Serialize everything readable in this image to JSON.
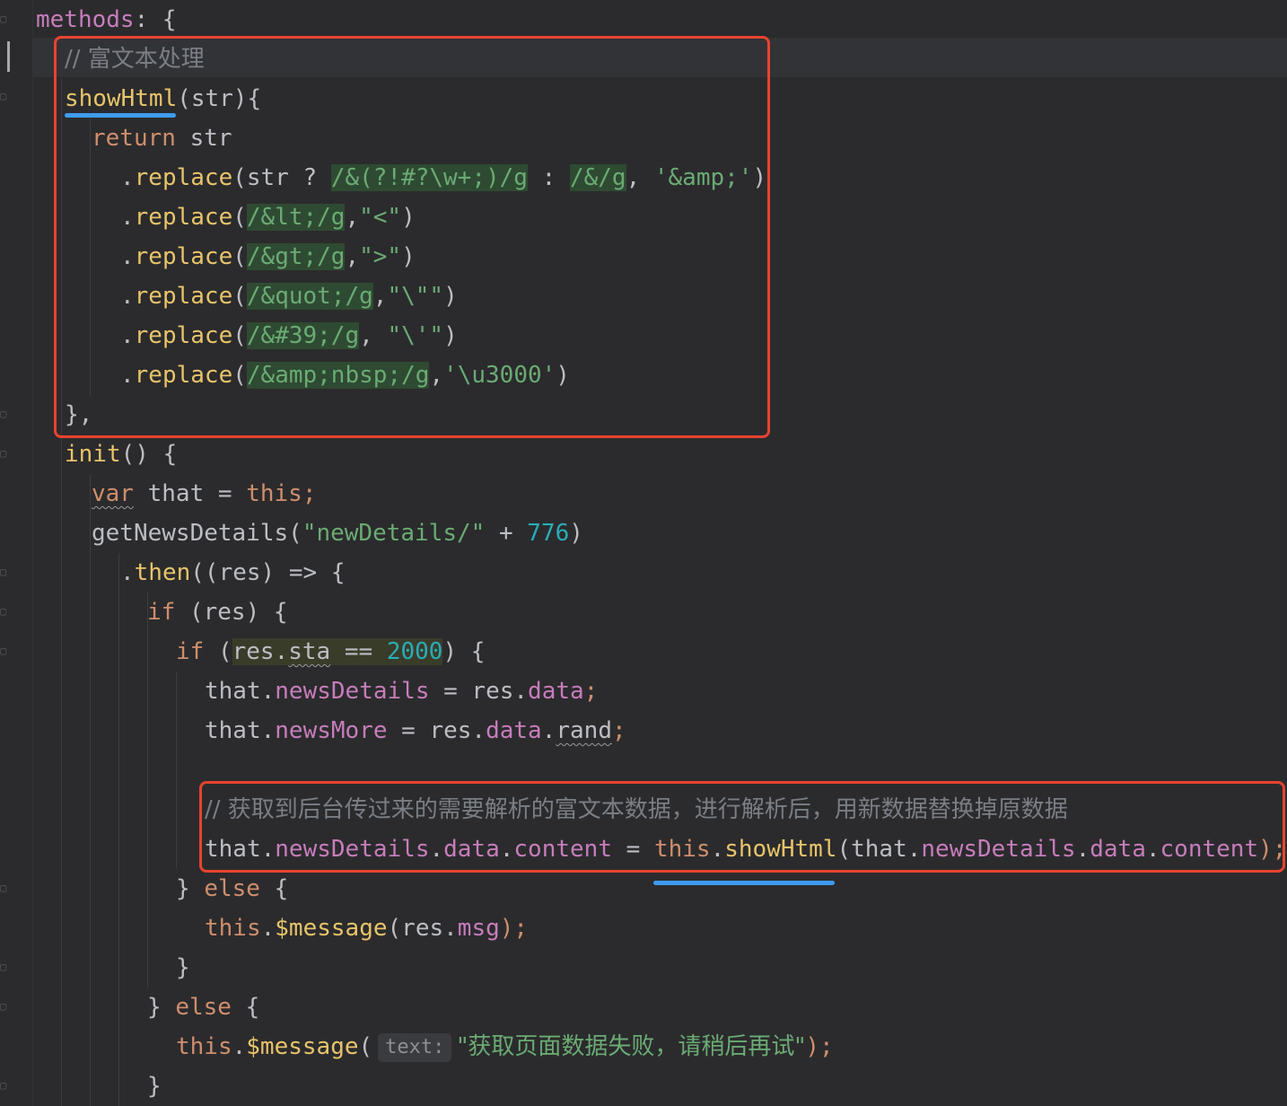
{
  "lines": {
    "l0": {
      "a": "methods",
      "b": ": {"
    },
    "l1": {
      "a": "// 富文本处理"
    },
    "l2": {
      "a": "showHtml",
      "b": "(str){"
    },
    "l3": {
      "a": "return",
      "b": " str"
    },
    "l4": {
      "a": ".",
      "b": "replace",
      "c": "(str ? ",
      "d": "/&(?!#?\\w+;)/g",
      "e": " : ",
      "f": "/&/g",
      "g": ", ",
      "h": "'&amp;'",
      "i": ")"
    },
    "l5": {
      "a": ".",
      "b": "replace",
      "c": "(",
      "d": "/&lt;/g",
      "e": ",",
      "f": "\"<\"",
      "g": ")"
    },
    "l6": {
      "a": ".",
      "b": "replace",
      "c": "(",
      "d": "/&gt;/g",
      "e": ",",
      "f": "\">\"",
      "g": ")"
    },
    "l7": {
      "a": ".",
      "b": "replace",
      "c": "(",
      "d": "/&quot;/g",
      "e": ",",
      "f": "\"\\\"\"",
      "g": ")"
    },
    "l8": {
      "a": ".",
      "b": "replace",
      "c": "(",
      "d": "/&#39;/g",
      "e": ", ",
      "f": "\"\\'\"",
      "g": ")"
    },
    "l9": {
      "a": ".",
      "b": "replace",
      "c": "(",
      "d": "/&amp;nbsp;/g",
      "e": ",",
      "f": "'\\u3000'",
      "g": ")"
    },
    "l10": {
      "a": "},"
    },
    "l11": {
      "a": "init",
      "b": "() {"
    },
    "l12": {
      "a": "var",
      "b": " that = ",
      "c": "this;"
    },
    "l13": {
      "a": "getNewsDetails(",
      "b": "\"newDetails/\"",
      "c": " + ",
      "d": "776",
      "e": ")"
    },
    "l14": {
      "a": ".",
      "b": "then",
      "c": "((res) => {"
    },
    "l15": {
      "a": "if",
      "b": " (res) {"
    },
    "l16": {
      "a": "if",
      "b": " (",
      "c": "res.",
      "d": "sta",
      "e": " == ",
      "f": "2000",
      "g": ") {"
    },
    "l17": {
      "a": "that.",
      "b": "newsDetails",
      "c": " = res.",
      "d": "data",
      "e": ";"
    },
    "l18": {
      "a": "that.",
      "b": "newsMore",
      "c": " = res.",
      "d": "data",
      "e": ".",
      "f": "rand",
      "g": ";"
    },
    "l19": {
      "a": "// 获取到后台传过来的需要解析的富文本数据，进行解析后，用新数据替换掉原数据"
    },
    "l20": {
      "a": "that.",
      "b": "newsDetails",
      "c": ".",
      "d": "data",
      "e": ".",
      "f": "content",
      "g": " = ",
      "h": "this",
      "i": ".",
      "j": "showHtml",
      "k": "(that.",
      "l": "newsDetails",
      "m": ".",
      "n": "data",
      "o": ".",
      "p": "content",
      "q": ");"
    },
    "l21": {
      "a": "} ",
      "b": "else",
      "c": " {"
    },
    "l22": {
      "a": "this",
      "b": ".",
      "c": "$message",
      "d": "(res.",
      "e": "msg",
      "f": ");"
    },
    "l23": {
      "a": "}"
    },
    "l24": {
      "a": "} ",
      "b": "else",
      "c": " {"
    },
    "l25": {
      "a": "this",
      "b": ".",
      "c": "$message",
      "d": "(",
      "hint": "text:",
      "e": "\"获取页面数据失败，请稍后再试\"",
      "f": ");"
    },
    "l26": {
      "a": "}"
    }
  },
  "colors": {
    "annotation_box": "#e8432f",
    "annotation_underline": "#3d9cf0"
  },
  "icons": [
    "fold-marker-icon"
  ]
}
